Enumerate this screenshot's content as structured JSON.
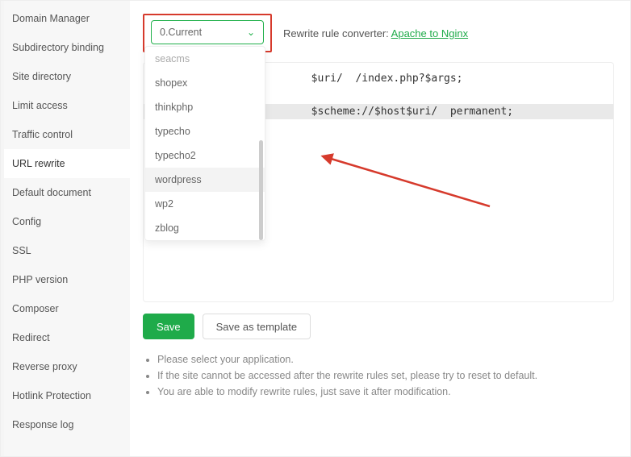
{
  "sidebar": {
    "items": [
      {
        "label": "Domain Manager"
      },
      {
        "label": "Subdirectory binding"
      },
      {
        "label": "Site directory"
      },
      {
        "label": "Limit access"
      },
      {
        "label": "Traffic control"
      },
      {
        "label": "URL rewrite"
      },
      {
        "label": "Default document"
      },
      {
        "label": "Config"
      },
      {
        "label": "SSL"
      },
      {
        "label": "PHP version"
      },
      {
        "label": "Composer"
      },
      {
        "label": "Redirect"
      },
      {
        "label": "Reverse proxy"
      },
      {
        "label": "Hotlink Protection"
      },
      {
        "label": "Response log"
      }
    ]
  },
  "select": {
    "current": "0.Current"
  },
  "converter": {
    "label": "Rewrite rule converter: ",
    "link": "Apache to Nginx"
  },
  "dropdown": {
    "items": [
      {
        "label": "seacms",
        "muted": true
      },
      {
        "label": "shopex"
      },
      {
        "label": "thinkphp"
      },
      {
        "label": "typecho"
      },
      {
        "label": "typecho2"
      },
      {
        "label": "wordpress",
        "hover": true
      },
      {
        "label": "wp2"
      },
      {
        "label": "zblog"
      }
    ]
  },
  "code": {
    "line1": "                         $uri/  /index.php?$args;",
    "line2": "                         $scheme://$host$uri/  permanent;"
  },
  "buttons": {
    "save": "Save",
    "save_tpl": "Save as template"
  },
  "notes": {
    "n1": "Please select your application.",
    "n2": "If the site cannot be accessed after the rewrite rules set, please try to reset to default.",
    "n3": "You are able to modify rewrite rules, just save it after modification."
  }
}
